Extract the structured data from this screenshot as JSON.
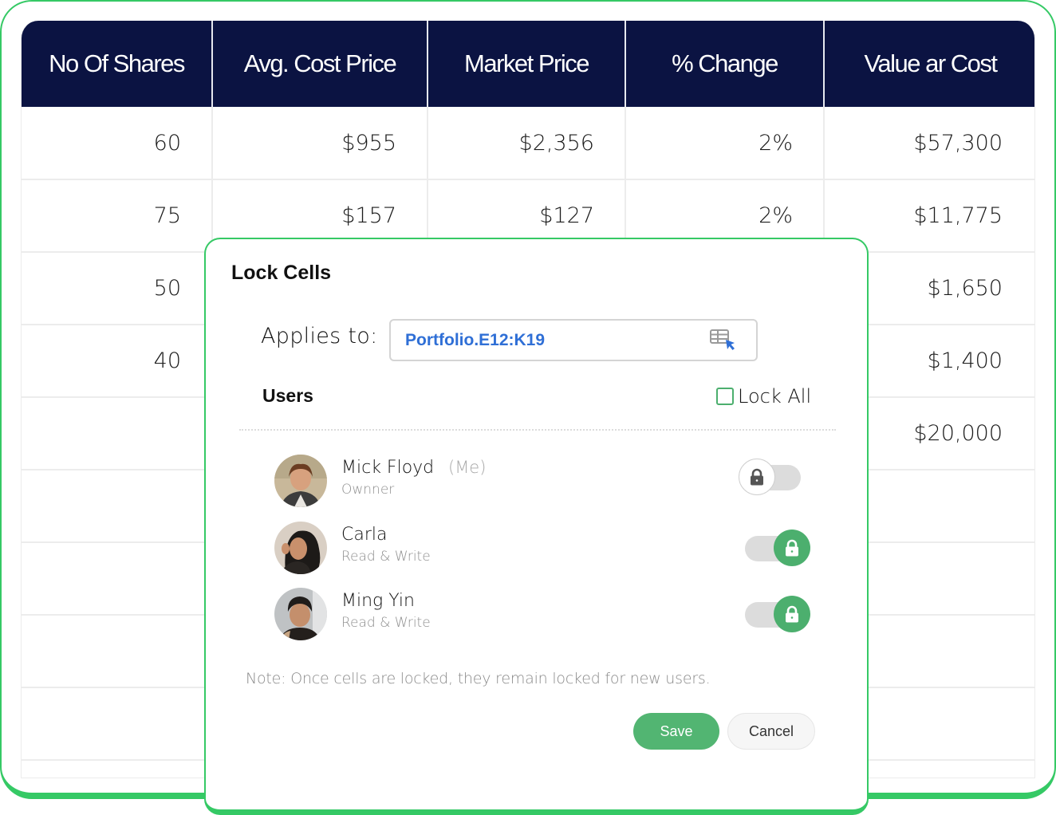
{
  "sheet": {
    "headers": [
      "No Of Shares",
      "Avg. Cost Price",
      "Market Price",
      "% Change",
      "Value ar Cost"
    ],
    "rows": [
      [
        "60",
        "$955",
        "$2,356",
        "2%",
        "$57,300"
      ],
      [
        "75",
        "$157",
        "$127",
        "2%",
        "$11,775"
      ],
      [
        "50",
        "",
        "",
        "",
        "$1,650"
      ],
      [
        "40",
        "",
        "",
        "",
        "$1,400"
      ],
      [
        "",
        "",
        "",
        "",
        "$20,000"
      ],
      [
        "",
        "",
        "",
        "",
        ""
      ],
      [
        "",
        "",
        "",
        "",
        ""
      ],
      [
        "",
        "",
        "",
        "",
        ""
      ],
      [
        "",
        "",
        "",
        "",
        ""
      ]
    ]
  },
  "dialog": {
    "title": "Lock Cells",
    "applies_label": "Applies to:",
    "range_value": "Portfolio.E12:K19",
    "range_icon": "select-range-icon",
    "users_label": "Users",
    "lock_all_label": "Lock All",
    "lock_all_checked": false,
    "users": [
      {
        "name": "Mick Floyd",
        "tag": "(Me)",
        "role": "Ownner",
        "locked": false
      },
      {
        "name": "Carla",
        "tag": "",
        "role": "Read & Write",
        "locked": true
      },
      {
        "name": "Ming Yin",
        "tag": "",
        "role": "Read & Write",
        "locked": true
      }
    ],
    "note": "Note: Once cells are locked, they remain locked for new users.",
    "save_label": "Save",
    "cancel_label": "Cancel"
  },
  "colors": {
    "accent_green": "#35c965",
    "toggle_on": "#4caf6e",
    "header_navy": "#0b1342",
    "range_blue": "#2f6fd6"
  }
}
